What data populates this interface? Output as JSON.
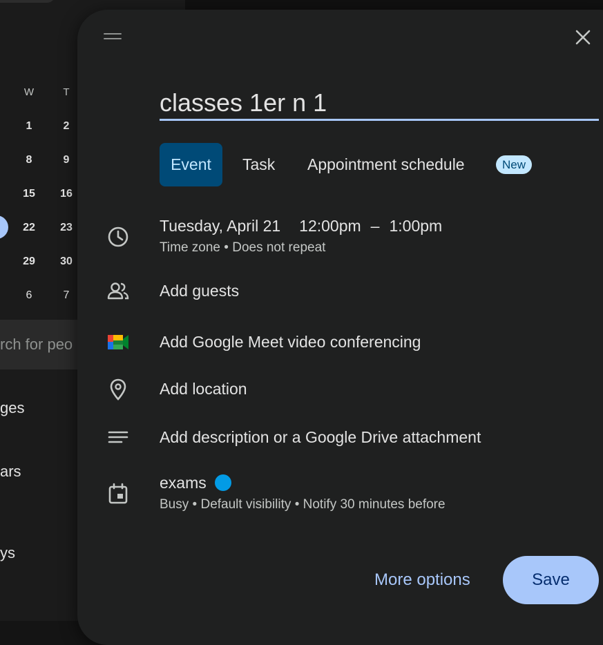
{
  "background_calendar": {
    "weekday_headers": [
      "W",
      "T"
    ],
    "weeks": [
      [
        "1",
        "2"
      ],
      [
        "8",
        "9"
      ],
      [
        "15",
        "16"
      ],
      [
        "22",
        "23"
      ],
      [
        "29",
        "30"
      ],
      [
        "6",
        "7"
      ]
    ],
    "search_placeholder": "rch for peo",
    "sidebar_labels": [
      "ges",
      "ars",
      "ys"
    ]
  },
  "dialog": {
    "title_value": "classes 1er n 1",
    "tabs": {
      "event": "Event",
      "task": "Task",
      "appointment": "Appointment schedule",
      "new_badge": "New"
    },
    "datetime": {
      "date": "Tuesday, April 21",
      "start": "12:00pm",
      "separator": "–",
      "end": "1:00pm",
      "timezone": "Time zone",
      "dot": "•",
      "repeat": "Does not repeat"
    },
    "guests": "Add guests",
    "meet": "Add Google Meet video conferencing",
    "location": "Add location",
    "description": "Add description or a Google Drive attachment",
    "calendar": {
      "name": "exams",
      "color": "#039be5",
      "busy": "Busy",
      "visibility": "Default visibility",
      "notify": "Notify 30 minutes before",
      "dot": "•"
    },
    "more_options": "More options",
    "save": "Save"
  },
  "colors": {
    "accent": "#a8c7fa",
    "tab_selected_bg": "#004a77",
    "badge_bg": "#c2e7ff"
  },
  "icons": [
    "drag-handle-icon",
    "close-icon",
    "clock-icon",
    "people-icon",
    "google-meet-icon",
    "location-pin-icon",
    "description-icon",
    "calendar-icon"
  ]
}
